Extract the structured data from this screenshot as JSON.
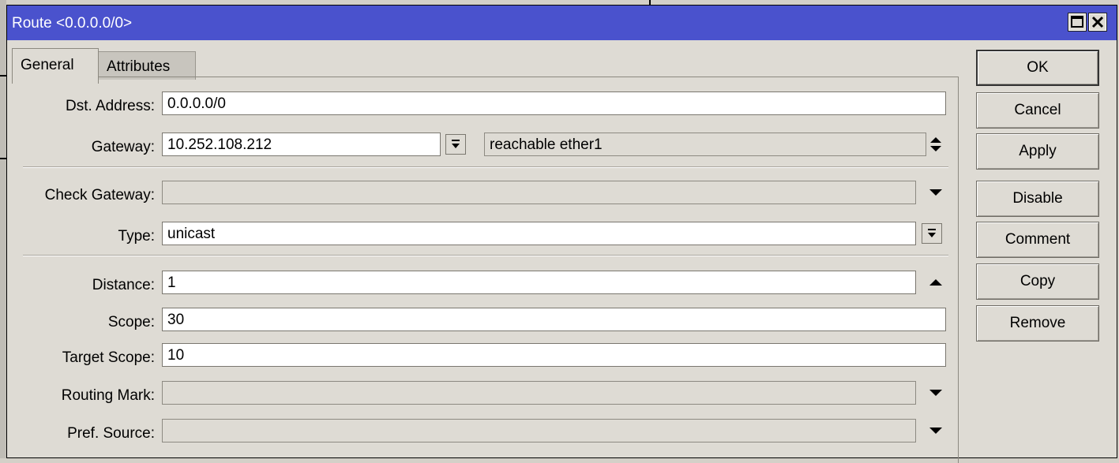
{
  "window": {
    "title": "Route <0.0.0.0/0>",
    "title_bar_color": "#4a52cd"
  },
  "tabs": [
    {
      "label": "General",
      "active": true
    },
    {
      "label": "Attributes",
      "active": false
    }
  ],
  "form": {
    "dst_address": {
      "label": "Dst. Address:",
      "value": "0.0.0.0/0"
    },
    "gateway": {
      "label": "Gateway:",
      "value": "10.252.108.212",
      "status": "reachable ether1"
    },
    "check_gateway": {
      "label": "Check Gateway:",
      "value": ""
    },
    "type": {
      "label": "Type:",
      "value": "unicast"
    },
    "distance": {
      "label": "Distance:",
      "value": "1"
    },
    "scope": {
      "label": "Scope:",
      "value": "30"
    },
    "target_scope": {
      "label": "Target Scope:",
      "value": "10"
    },
    "routing_mark": {
      "label": "Routing Mark:",
      "value": ""
    },
    "pref_source": {
      "label": "Pref. Source:",
      "value": ""
    }
  },
  "buttons": {
    "ok": "OK",
    "cancel": "Cancel",
    "apply": "Apply",
    "disable": "Disable",
    "comment": "Comment",
    "copy": "Copy",
    "remove": "Remove"
  },
  "icons": {
    "maximize": "maximize-icon",
    "close": "close-icon",
    "dropdown": "dropdown-arrow-icon",
    "updown": "up-down-icon",
    "up": "up-arrow-icon",
    "down": "down-arrow-icon"
  }
}
